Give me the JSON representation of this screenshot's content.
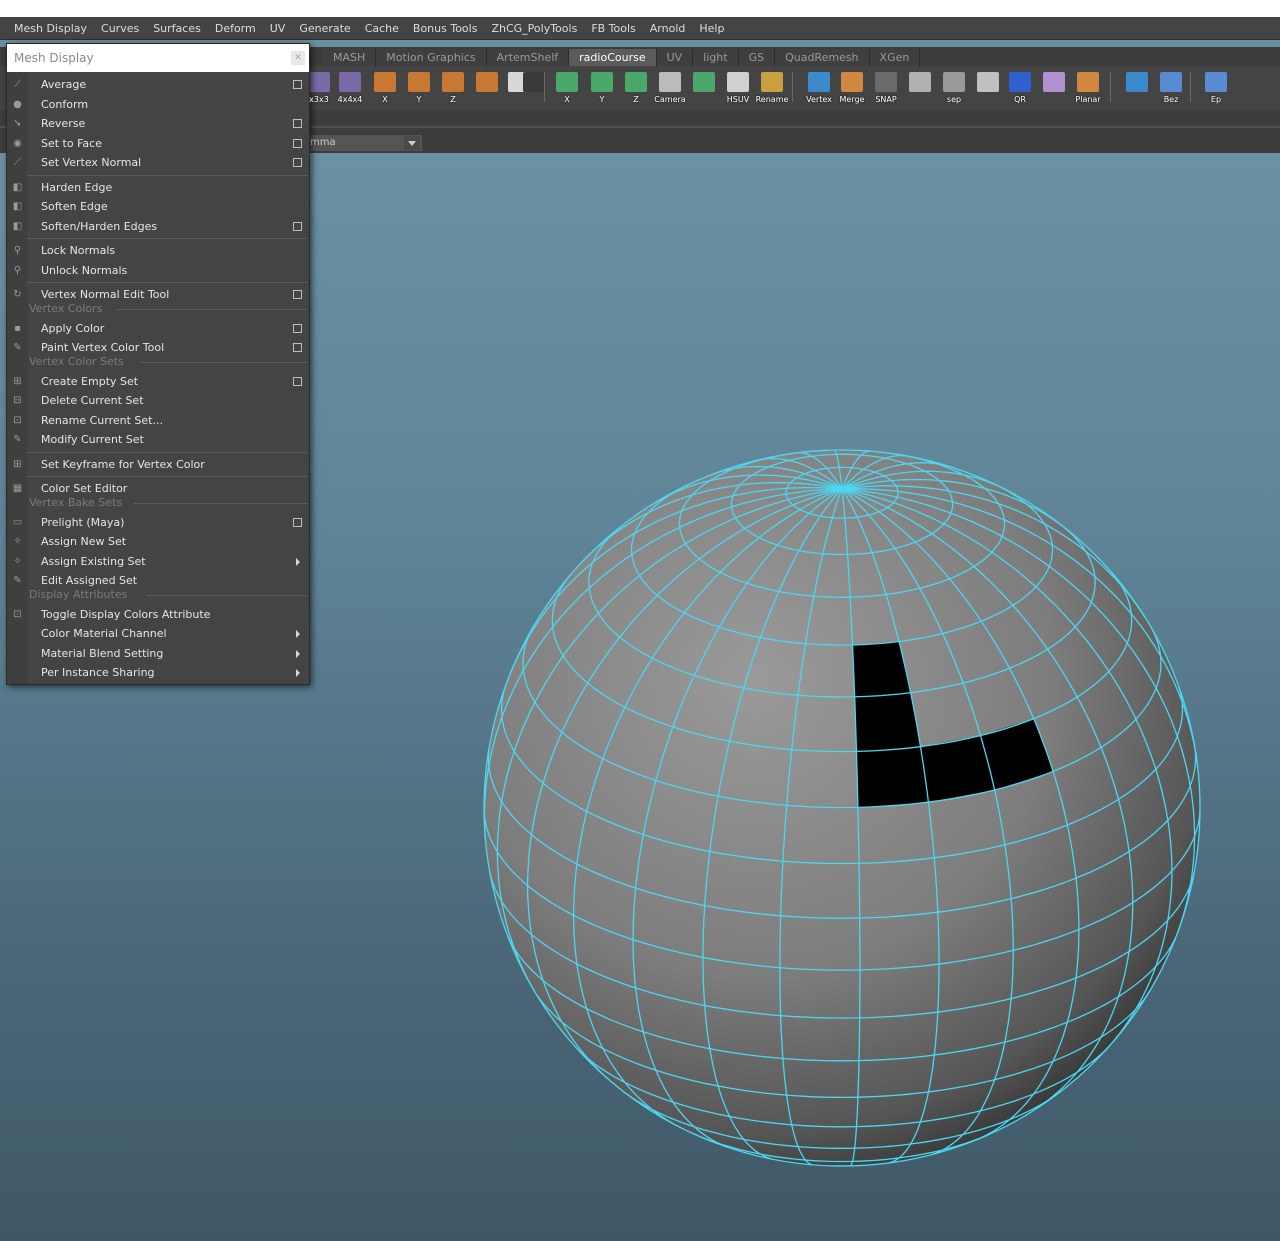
{
  "menubar": [
    "Mesh Display",
    "Curves",
    "Surfaces",
    "Deform",
    "UV",
    "Generate",
    "Cache",
    "Bonus Tools",
    "ZhCG_PolyTools",
    "FB Tools",
    "Arnold",
    "Help"
  ],
  "shelf_tabs": [
    {
      "label": "MASH",
      "active": false
    },
    {
      "label": "Motion Graphics",
      "active": false
    },
    {
      "label": "ArtemShelf",
      "active": false
    },
    {
      "label": "radioCourse",
      "active": true
    },
    {
      "label": "UV",
      "active": false
    },
    {
      "label": "light",
      "active": false
    },
    {
      "label": "GS",
      "active": false
    },
    {
      "label": "QuadRemesh",
      "active": false
    },
    {
      "label": "XGen",
      "active": false
    }
  ],
  "shelf_buttons": [
    "x3x3",
    "4x4x4",
    "X",
    "Y",
    "Z",
    "",
    "",
    "",
    "X",
    "Y",
    "Z",
    "Camera",
    "",
    "HSUV",
    "Rename",
    "Vertex",
    "Merge",
    "SNAP",
    "",
    "sep",
    "",
    "QR",
    "",
    "Planar",
    "",
    "Bez",
    "Ep"
  ],
  "combo_value": "mma",
  "menu": {
    "title": "Mesh Display",
    "items": [
      {
        "type": "item",
        "label": "Average",
        "icon": "average-icon",
        "glyph": "⟋",
        "option": true
      },
      {
        "type": "item",
        "label": "Conform",
        "icon": "conform-icon",
        "glyph": "●",
        "option": false
      },
      {
        "type": "item",
        "label": "Reverse",
        "icon": "reverse-icon",
        "glyph": "➘",
        "option": true
      },
      {
        "type": "item",
        "label": "Set to Face",
        "icon": "set-to-face-icon",
        "glyph": "◉",
        "option": true
      },
      {
        "type": "item",
        "label": "Set Vertex Normal",
        "icon": "set-vertex-normal-icon",
        "glyph": "⟋",
        "option": true
      },
      {
        "type": "sep"
      },
      {
        "type": "item",
        "label": "Harden Edge",
        "icon": "harden-edge-icon",
        "glyph": "◧",
        "option": false
      },
      {
        "type": "item",
        "label": "Soften Edge",
        "icon": "soften-edge-icon",
        "glyph": "◧",
        "option": false
      },
      {
        "type": "item",
        "label": "Soften/Harden Edges",
        "icon": "soften-harden-icon",
        "glyph": "◧",
        "option": true
      },
      {
        "type": "sep"
      },
      {
        "type": "item",
        "label": "Lock Normals",
        "icon": "lock-normals-icon",
        "glyph": "⚲",
        "option": false
      },
      {
        "type": "item",
        "label": "Unlock Normals",
        "icon": "unlock-normals-icon",
        "glyph": "⚲",
        "option": false
      },
      {
        "type": "sep"
      },
      {
        "type": "item",
        "label": "Vertex Normal Edit Tool",
        "icon": "vertex-normal-edit-icon",
        "glyph": "↻",
        "option": true
      },
      {
        "type": "header",
        "label": "Vertex Colors"
      },
      {
        "type": "item",
        "label": "Apply Color",
        "icon": "apply-color-icon",
        "glyph": "▪",
        "option": true
      },
      {
        "type": "item",
        "label": "Paint Vertex Color Tool",
        "icon": "paint-brush-icon",
        "glyph": "✎",
        "option": true
      },
      {
        "type": "header",
        "label": "Vertex Color Sets"
      },
      {
        "type": "item",
        "label": "Create Empty Set",
        "icon": "create-set-icon",
        "glyph": "⊞",
        "option": true
      },
      {
        "type": "item",
        "label": "Delete Current Set",
        "icon": "delete-set-icon",
        "glyph": "⊟",
        "option": false
      },
      {
        "type": "item",
        "label": "Rename Current Set...",
        "icon": "rename-set-icon",
        "glyph": "⊡",
        "option": false
      },
      {
        "type": "item",
        "label": "Modify Current Set",
        "icon": "modify-set-icon",
        "glyph": "✎",
        "option": false
      },
      {
        "type": "sep"
      },
      {
        "type": "item",
        "label": "Set Keyframe for Vertex Color",
        "icon": "keyframe-icon",
        "glyph": "⊞",
        "option": false
      },
      {
        "type": "sep"
      },
      {
        "type": "item",
        "label": "Color Set Editor",
        "icon": "color-set-editor-icon",
        "glyph": "▦",
        "option": false
      },
      {
        "type": "header",
        "label": "Vertex Bake Sets"
      },
      {
        "type": "item",
        "label": "Prelight (Maya)",
        "icon": "prelight-icon",
        "glyph": "▭",
        "option": true
      },
      {
        "type": "item",
        "label": "Assign New Set",
        "icon": "assign-new-set-icon",
        "glyph": "✧",
        "option": false
      },
      {
        "type": "item",
        "label": "Assign Existing Set",
        "icon": "assign-existing-set-icon",
        "glyph": "✧",
        "submenu": true
      },
      {
        "type": "item",
        "label": "Edit Assigned Set",
        "icon": "edit-assigned-set-icon",
        "glyph": "✎",
        "option": false
      },
      {
        "type": "header",
        "label": "Display Attributes"
      },
      {
        "type": "item",
        "label": "Toggle Display Colors Attribute",
        "icon": "toggle-display-colors-icon",
        "glyph": "⊡",
        "option": false
      },
      {
        "type": "item",
        "label": "Color Material Channel",
        "icon": "",
        "glyph": "",
        "submenu": true
      },
      {
        "type": "item",
        "label": "Material Blend Setting",
        "icon": "",
        "glyph": "",
        "submenu": true
      },
      {
        "type": "item",
        "label": "Per Instance Sharing",
        "icon": "",
        "glyph": "",
        "submenu": true
      }
    ]
  },
  "colors": {
    "wireframe": "#4cd6f2",
    "mesh_face": "#8a8a8a",
    "painted_face": "#000000",
    "viewport_top": "#6b91a3",
    "viewport_bottom": "#3f5866",
    "active_tab": "#5b5b5b"
  }
}
